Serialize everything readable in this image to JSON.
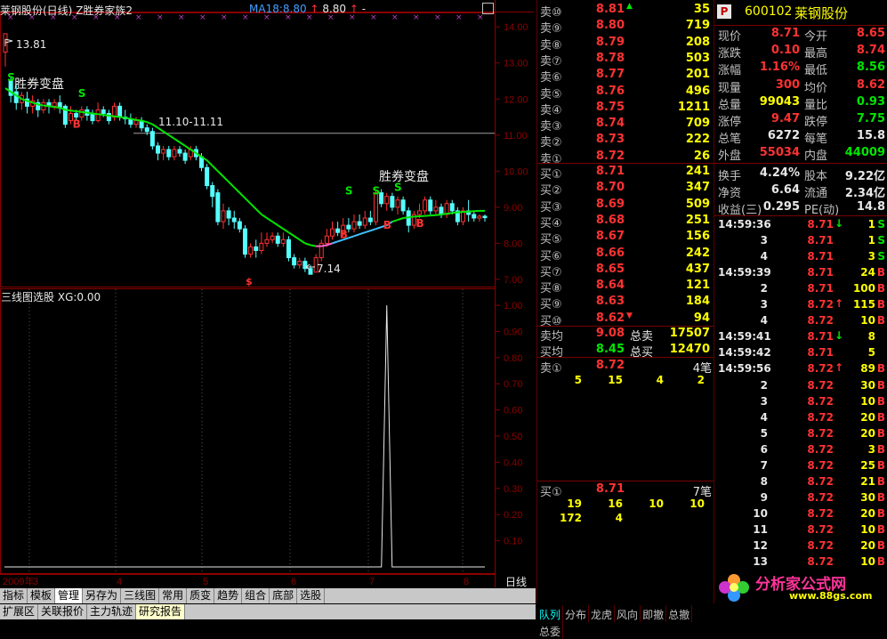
{
  "chart": {
    "title": "莱钢股份(日线)",
    "indicator": "Z胜券家族2",
    "ma_label": "MA18:8.80",
    "ma_value2": "8.80",
    "ma_extra": "-",
    "max_price_label": "13.81",
    "min_price_label": "7.14",
    "range_label": "11.10-11.11",
    "annotation_top": "胜券变盘",
    "annotation_mid": "胜券变盘",
    "price_axis": [
      "14.00",
      "13.00",
      "12.00",
      "11.00",
      "10.00",
      "9.00",
      "8.00",
      "7.00"
    ],
    "sub_title": "三线图选股",
    "sub_value": "XG:0.00",
    "sub_axis": [
      "1.00",
      "0.90",
      "0.80",
      "0.70",
      "0.60",
      "0.50",
      "0.40",
      "0.30",
      "0.20",
      "0.10"
    ],
    "x_axis": [
      "2009年",
      "3",
      "4",
      "5",
      "6",
      "7",
      "8"
    ],
    "period_label": "日线"
  },
  "chart_data": {
    "type": "line",
    "title": "莱钢股份(日线)",
    "ylim": [
      6.8,
      14.4
    ],
    "candles": [
      {
        "o": 13.3,
        "c": 13.81,
        "h": 13.81,
        "l": 12.9
      },
      {
        "o": 12.5,
        "c": 12.1,
        "h": 12.6,
        "l": 11.9
      },
      {
        "o": 12.2,
        "c": 11.9,
        "h": 12.4,
        "l": 11.7
      },
      {
        "o": 11.9,
        "c": 12.1,
        "h": 12.2,
        "l": 11.7
      },
      {
        "o": 12.0,
        "c": 11.8,
        "h": 12.2,
        "l": 11.6
      },
      {
        "o": 11.8,
        "c": 11.95,
        "h": 12.1,
        "l": 11.6
      },
      {
        "o": 11.9,
        "c": 11.7,
        "h": 12.0,
        "l": 11.5
      },
      {
        "o": 11.7,
        "c": 11.9,
        "h": 12.0,
        "l": 11.6
      },
      {
        "o": 11.9,
        "c": 11.8,
        "h": 12.0,
        "l": 11.6
      },
      {
        "o": 11.8,
        "c": 11.9,
        "h": 12.0,
        "l": 11.7
      },
      {
        "o": 11.9,
        "c": 11.75,
        "h": 12.1,
        "l": 11.6
      },
      {
        "o": 11.8,
        "c": 11.3,
        "h": 11.85,
        "l": 11.2
      },
      {
        "o": 11.4,
        "c": 11.6,
        "h": 11.8,
        "l": 11.3
      },
      {
        "o": 11.6,
        "c": 11.5,
        "h": 11.7,
        "l": 11.4
      },
      {
        "o": 11.5,
        "c": 11.7,
        "h": 11.8,
        "l": 11.4
      },
      {
        "o": 11.7,
        "c": 11.55,
        "h": 11.8,
        "l": 11.4
      },
      {
        "o": 11.6,
        "c": 11.4,
        "h": 11.7,
        "l": 11.3
      },
      {
        "o": 11.4,
        "c": 11.7,
        "h": 11.9,
        "l": 11.35
      },
      {
        "o": 11.7,
        "c": 11.6,
        "h": 11.8,
        "l": 11.5
      },
      {
        "o": 11.6,
        "c": 11.4,
        "h": 11.7,
        "l": 11.3
      },
      {
        "o": 11.5,
        "c": 11.8,
        "h": 11.9,
        "l": 11.4
      },
      {
        "o": 11.8,
        "c": 11.5,
        "h": 11.9,
        "l": 11.4
      },
      {
        "o": 11.5,
        "c": 11.45,
        "h": 11.7,
        "l": 11.3
      },
      {
        "o": 11.45,
        "c": 11.3,
        "h": 11.6,
        "l": 11.2
      },
      {
        "o": 11.3,
        "c": 11.4,
        "h": 11.5,
        "l": 11.2
      },
      {
        "o": 11.4,
        "c": 11.2,
        "h": 11.5,
        "l": 11.1
      },
      {
        "o": 11.2,
        "c": 11.1,
        "h": 11.3,
        "l": 11.0
      },
      {
        "o": 11.1,
        "c": 10.7,
        "h": 11.2,
        "l": 10.6
      },
      {
        "o": 10.7,
        "c": 10.5,
        "h": 10.8,
        "l": 10.3
      },
      {
        "o": 10.5,
        "c": 10.6,
        "h": 10.7,
        "l": 10.3
      },
      {
        "o": 10.6,
        "c": 10.4,
        "h": 10.7,
        "l": 10.3
      },
      {
        "o": 10.4,
        "c": 10.6,
        "h": 10.7,
        "l": 10.3
      },
      {
        "o": 10.6,
        "c": 10.5,
        "h": 10.7,
        "l": 10.4
      },
      {
        "o": 10.5,
        "c": 10.3,
        "h": 10.6,
        "l": 10.2
      },
      {
        "o": 10.4,
        "c": 10.6,
        "h": 10.7,
        "l": 10.3
      },
      {
        "o": 10.6,
        "c": 10.4,
        "h": 10.7,
        "l": 10.3
      },
      {
        "o": 10.4,
        "c": 10.1,
        "h": 10.5,
        "l": 10.0
      },
      {
        "o": 10.1,
        "c": 9.6,
        "h": 10.2,
        "l": 9.5
      },
      {
        "o": 9.6,
        "c": 9.3,
        "h": 9.7,
        "l": 9.0
      },
      {
        "o": 9.4,
        "c": 8.6,
        "h": 9.5,
        "l": 8.5
      },
      {
        "o": 8.6,
        "c": 8.9,
        "h": 9.1,
        "l": 8.4
      },
      {
        "o": 8.9,
        "c": 8.7,
        "h": 9.0,
        "l": 8.5
      },
      {
        "o": 8.7,
        "c": 8.6,
        "h": 8.9,
        "l": 8.4
      },
      {
        "o": 8.6,
        "c": 8.4,
        "h": 8.7,
        "l": 8.3
      },
      {
        "o": 8.4,
        "c": 7.7,
        "h": 8.5,
        "l": 7.6
      },
      {
        "o": 7.7,
        "c": 7.9,
        "h": 8.0,
        "l": 7.6
      },
      {
        "o": 7.9,
        "c": 7.8,
        "h": 8.1,
        "l": 7.6
      },
      {
        "o": 7.8,
        "c": 8.0,
        "h": 8.3,
        "l": 7.7
      },
      {
        "o": 8.0,
        "c": 8.1,
        "h": 8.3,
        "l": 7.9
      },
      {
        "o": 8.1,
        "c": 8.2,
        "h": 8.3,
        "l": 8.0
      },
      {
        "o": 8.2,
        "c": 8.0,
        "h": 8.3,
        "l": 7.9
      },
      {
        "o": 8.0,
        "c": 8.1,
        "h": 8.3,
        "l": 7.9
      },
      {
        "o": 8.1,
        "c": 7.6,
        "h": 8.2,
        "l": 7.5
      },
      {
        "o": 7.6,
        "c": 7.4,
        "h": 7.7,
        "l": 7.3
      },
      {
        "o": 7.4,
        "c": 7.5,
        "h": 7.6,
        "l": 7.3
      },
      {
        "o": 7.5,
        "c": 7.3,
        "h": 7.6,
        "l": 7.2
      },
      {
        "o": 7.3,
        "c": 7.14,
        "h": 7.4,
        "l": 7.14
      },
      {
        "o": 7.2,
        "c": 7.6,
        "h": 7.7,
        "l": 7.2
      },
      {
        "o": 7.6,
        "c": 8.0,
        "h": 8.1,
        "l": 7.5
      },
      {
        "o": 8.0,
        "c": 8.2,
        "h": 8.4,
        "l": 7.9
      },
      {
        "o": 8.2,
        "c": 8.4,
        "h": 8.6,
        "l": 8.1
      },
      {
        "o": 8.4,
        "c": 8.3,
        "h": 8.6,
        "l": 8.2
      },
      {
        "o": 8.3,
        "c": 8.5,
        "h": 8.7,
        "l": 8.2
      },
      {
        "o": 8.5,
        "c": 8.4,
        "h": 8.7,
        "l": 8.3
      },
      {
        "o": 8.4,
        "c": 8.6,
        "h": 8.8,
        "l": 8.3
      },
      {
        "o": 8.6,
        "c": 8.5,
        "h": 8.8,
        "l": 8.4
      },
      {
        "o": 8.5,
        "c": 8.7,
        "h": 8.9,
        "l": 8.4
      },
      {
        "o": 8.7,
        "c": 8.6,
        "h": 8.9,
        "l": 8.5
      },
      {
        "o": 8.6,
        "c": 9.4,
        "h": 9.5,
        "l": 8.5
      },
      {
        "o": 9.4,
        "c": 9.1,
        "h": 9.5,
        "l": 9.0
      },
      {
        "o": 9.1,
        "c": 9.3,
        "h": 9.4,
        "l": 8.9
      },
      {
        "o": 9.3,
        "c": 9.0,
        "h": 9.4,
        "l": 8.9
      },
      {
        "o": 9.0,
        "c": 9.2,
        "h": 9.3,
        "l": 8.8
      },
      {
        "o": 9.2,
        "c": 8.9,
        "h": 9.3,
        "l": 8.8
      },
      {
        "o": 8.9,
        "c": 8.5,
        "h": 9.0,
        "l": 8.3
      },
      {
        "o": 8.5,
        "c": 8.8,
        "h": 8.9,
        "l": 8.4
      },
      {
        "o": 8.8,
        "c": 8.9,
        "h": 9.1,
        "l": 8.7
      },
      {
        "o": 8.9,
        "c": 9.2,
        "h": 9.3,
        "l": 8.8
      },
      {
        "o": 9.2,
        "c": 8.9,
        "h": 9.3,
        "l": 8.8
      },
      {
        "o": 8.9,
        "c": 9.0,
        "h": 9.2,
        "l": 8.8
      },
      {
        "o": 9.0,
        "c": 8.8,
        "h": 9.1,
        "l": 8.7
      },
      {
        "o": 8.8,
        "c": 9.1,
        "h": 9.2,
        "l": 8.7
      },
      {
        "o": 9.1,
        "c": 8.9,
        "h": 9.2,
        "l": 8.8
      },
      {
        "o": 8.9,
        "c": 8.6,
        "h": 9.0,
        "l": 8.5
      },
      {
        "o": 8.6,
        "c": 8.9,
        "h": 9.0,
        "l": 8.5
      },
      {
        "o": 8.9,
        "c": 8.8,
        "h": 9.2,
        "l": 8.6
      },
      {
        "o": 8.8,
        "c": 8.7,
        "h": 8.9,
        "l": 8.6
      },
      {
        "o": 8.7,
        "c": 8.75,
        "h": 8.8,
        "l": 8.6
      },
      {
        "o": 8.75,
        "c": 8.71,
        "h": 8.8,
        "l": 8.6
      }
    ],
    "ma": [
      12.3,
      12.2,
      12.1,
      12.0,
      11.95,
      11.9,
      11.85,
      11.82,
      11.8,
      11.78,
      11.76,
      11.7,
      11.68,
      11.66,
      11.64,
      11.62,
      11.6,
      11.58,
      11.56,
      11.54,
      11.52,
      11.5,
      11.48,
      11.45,
      11.42,
      11.4,
      11.36,
      11.3,
      11.2,
      11.1,
      11.0,
      10.9,
      10.8,
      10.7,
      10.6,
      10.5,
      10.4,
      10.3,
      10.15,
      10.0,
      9.85,
      9.7,
      9.55,
      9.4,
      9.25,
      9.1,
      8.95,
      8.8,
      8.7,
      8.6,
      8.5,
      8.4,
      8.3,
      8.2,
      8.1,
      8.0,
      7.95,
      7.92,
      7.92,
      7.95,
      8.0,
      8.05,
      8.1,
      8.15,
      8.2,
      8.25,
      8.3,
      8.35,
      8.4,
      8.45,
      8.5,
      8.6,
      8.65,
      8.7,
      8.72,
      8.74,
      8.75,
      8.76,
      8.77,
      8.78,
      8.8,
      8.82,
      8.84,
      8.86,
      8.87,
      8.88,
      8.89,
      8.9,
      8.9,
      8.88,
      8.86,
      8.84,
      8.82,
      8.8
    ],
    "xg_signal": {
      "index": 70,
      "value": 1.0
    }
  },
  "orderbook": {
    "sells": [
      {
        "label": "卖⑩",
        "price": "8.81",
        "qty": "35",
        "mark": "▲"
      },
      {
        "label": "卖⑨",
        "price": "8.80",
        "qty": "719"
      },
      {
        "label": "卖⑧",
        "price": "8.79",
        "qty": "208"
      },
      {
        "label": "卖⑦",
        "price": "8.78",
        "qty": "503"
      },
      {
        "label": "卖⑥",
        "price": "8.77",
        "qty": "201"
      },
      {
        "label": "卖⑤",
        "price": "8.76",
        "qty": "496"
      },
      {
        "label": "卖④",
        "price": "8.75",
        "qty": "1211"
      },
      {
        "label": "卖③",
        "price": "8.74",
        "qty": "709"
      },
      {
        "label": "卖②",
        "price": "8.73",
        "qty": "222"
      },
      {
        "label": "卖①",
        "price": "8.72",
        "qty": "26"
      }
    ],
    "buys": [
      {
        "label": "买①",
        "price": "8.71",
        "qty": "241"
      },
      {
        "label": "买②",
        "price": "8.70",
        "qty": "347"
      },
      {
        "label": "买③",
        "price": "8.69",
        "qty": "509"
      },
      {
        "label": "买④",
        "price": "8.68",
        "qty": "251"
      },
      {
        "label": "买⑤",
        "price": "8.67",
        "qty": "156"
      },
      {
        "label": "买⑥",
        "price": "8.66",
        "qty": "242"
      },
      {
        "label": "买⑦",
        "price": "8.65",
        "qty": "437"
      },
      {
        "label": "买⑧",
        "price": "8.64",
        "qty": "121"
      },
      {
        "label": "买⑨",
        "price": "8.63",
        "qty": "184"
      },
      {
        "label": "买⑩",
        "price": "8.62",
        "qty": "94",
        "mark": "▼"
      }
    ],
    "sell_avg_label": "卖均",
    "sell_avg": "9.08",
    "sell_total_label": "总卖",
    "sell_total": "17507",
    "buy_avg_label": "买均",
    "buy_avg": "8.45",
    "buy_total_label": "总买",
    "buy_total": "12470",
    "sell1_queue": {
      "label": "卖①",
      "price": "8.72",
      "count": "4笔",
      "orders": [
        "5",
        "15",
        "4",
        "2"
      ]
    },
    "buy1_queue": {
      "label": "买①",
      "price": "8.71",
      "count": "7笔",
      "orders": [
        "19",
        "16",
        "10",
        "10",
        "172",
        "4"
      ]
    },
    "tabs": [
      "队列",
      "分布",
      "龙虎",
      "风向",
      "即撤",
      "总撤",
      "总委"
    ]
  },
  "quote": {
    "badge": "P",
    "code": "600102",
    "name": "莱钢股份",
    "rows": [
      {
        "k": "现价",
        "v": "8.71",
        "vc": "red",
        "k2": "今开",
        "v2": "8.65",
        "v2c": "red"
      },
      {
        "k": "涨跌",
        "v": "0.10",
        "vc": "red",
        "k2": "最高",
        "v2": "8.74",
        "v2c": "red"
      },
      {
        "k": "涨幅",
        "v": "1.16%",
        "vc": "red",
        "k2": "最低",
        "v2": "8.56",
        "v2c": "green"
      },
      {
        "k": "现量",
        "v": "300",
        "vc": "red",
        "k2": "均价",
        "v2": "8.62",
        "v2c": "red"
      },
      {
        "k": "总量",
        "v": "99043",
        "vc": "yellow",
        "k2": "量比",
        "v2": "0.93",
        "v2c": "green"
      },
      {
        "k": "涨停",
        "v": "9.47",
        "vc": "red",
        "k2": "跌停",
        "v2": "7.75",
        "v2c": "green"
      },
      {
        "k": "总笔",
        "v": "6272",
        "vc": "white",
        "k2": "每笔",
        "v2": "15.8",
        "v2c": "white"
      },
      {
        "k": "外盘",
        "v": "55034",
        "vc": "red",
        "k2": "内盘",
        "v2": "44009",
        "v2c": "green"
      },
      {
        "k": "换手",
        "v": "4.24%",
        "vc": "white",
        "k2": "股本",
        "v2": "9.22亿",
        "v2c": "white"
      },
      {
        "k": "净资",
        "v": "6.64",
        "vc": "white",
        "k2": "流通",
        "v2": "2.34亿",
        "v2c": "white"
      },
      {
        "k": "收益(三)",
        "v": "0.295",
        "vc": "white",
        "k2": "PE(动)",
        "v2": "14.8",
        "v2c": "white"
      }
    ],
    "ticks": [
      {
        "t": "14:59:36",
        "p": "8.71",
        "a": "↓",
        "ac": "green",
        "vol": "1",
        "bs": "S",
        "bsc": "green"
      },
      {
        "t": "3",
        "p": "8.71",
        "a": "",
        "ac": "",
        "vol": "1",
        "bs": "S",
        "bsc": "green"
      },
      {
        "t": "4",
        "p": "8.71",
        "a": "",
        "ac": "",
        "vol": "3",
        "bs": "S",
        "bsc": "green"
      },
      {
        "t": "14:59:39",
        "p": "8.71",
        "a": "",
        "ac": "",
        "vol": "24",
        "bs": "B",
        "bsc": "red"
      },
      {
        "t": "2",
        "p": "8.71",
        "a": "",
        "ac": "",
        "vol": "100",
        "bs": "B",
        "bsc": "red"
      },
      {
        "t": "3",
        "p": "8.72",
        "a": "↑",
        "ac": "red",
        "vol": "115",
        "bs": "B",
        "bsc": "red"
      },
      {
        "t": "4",
        "p": "8.72",
        "a": "",
        "ac": "",
        "vol": "10",
        "bs": "B",
        "bsc": "red"
      },
      {
        "t": "14:59:41",
        "p": "8.71",
        "a": "↓",
        "ac": "green",
        "vol": "8",
        "bs": "",
        "bsc": ""
      },
      {
        "t": "14:59:42",
        "p": "8.71",
        "a": "",
        "ac": "",
        "vol": "5",
        "bs": "",
        "bsc": ""
      },
      {
        "t": "14:59:56",
        "p": "8.72",
        "a": "↑",
        "ac": "red",
        "vol": "89",
        "bs": "B",
        "bsc": "red"
      },
      {
        "t": "2",
        "p": "8.72",
        "a": "",
        "ac": "",
        "vol": "30",
        "bs": "B",
        "bsc": "red"
      },
      {
        "t": "3",
        "p": "8.72",
        "a": "",
        "ac": "",
        "vol": "10",
        "bs": "B",
        "bsc": "red"
      },
      {
        "t": "4",
        "p": "8.72",
        "a": "",
        "ac": "",
        "vol": "20",
        "bs": "B",
        "bsc": "red"
      },
      {
        "t": "5",
        "p": "8.72",
        "a": "",
        "ac": "",
        "vol": "20",
        "bs": "B",
        "bsc": "red"
      },
      {
        "t": "6",
        "p": "8.72",
        "a": "",
        "ac": "",
        "vol": "3",
        "bs": "B",
        "bsc": "red"
      },
      {
        "t": "7",
        "p": "8.72",
        "a": "",
        "ac": "",
        "vol": "25",
        "bs": "B",
        "bsc": "red"
      },
      {
        "t": "8",
        "p": "8.72",
        "a": "",
        "ac": "",
        "vol": "21",
        "bs": "B",
        "bsc": "red"
      },
      {
        "t": "9",
        "p": "8.72",
        "a": "",
        "ac": "",
        "vol": "30",
        "bs": "B",
        "bsc": "red"
      },
      {
        "t": "10",
        "p": "8.72",
        "a": "",
        "ac": "",
        "vol": "20",
        "bs": "B",
        "bsc": "red"
      },
      {
        "t": "11",
        "p": "8.72",
        "a": "",
        "ac": "",
        "vol": "10",
        "bs": "B",
        "bsc": "red"
      },
      {
        "t": "12",
        "p": "8.72",
        "a": "",
        "ac": "",
        "vol": "20",
        "bs": "B",
        "bsc": "red"
      },
      {
        "t": "13",
        "p": "8.72",
        "a": "",
        "ac": "",
        "vol": "10",
        "bs": "B",
        "bsc": "red"
      }
    ],
    "logo_text": "分析家公式网",
    "logo_url": "www.88gs.com"
  },
  "tabs_row1": [
    "指标",
    "模板",
    "管理",
    "另存为",
    "三线图",
    "常用",
    "质变",
    "趋势",
    "组合",
    "底部",
    "选股"
  ],
  "tabs_row2": [
    "扩展区",
    "关联报价",
    "主力轨迹",
    "研究报告"
  ]
}
